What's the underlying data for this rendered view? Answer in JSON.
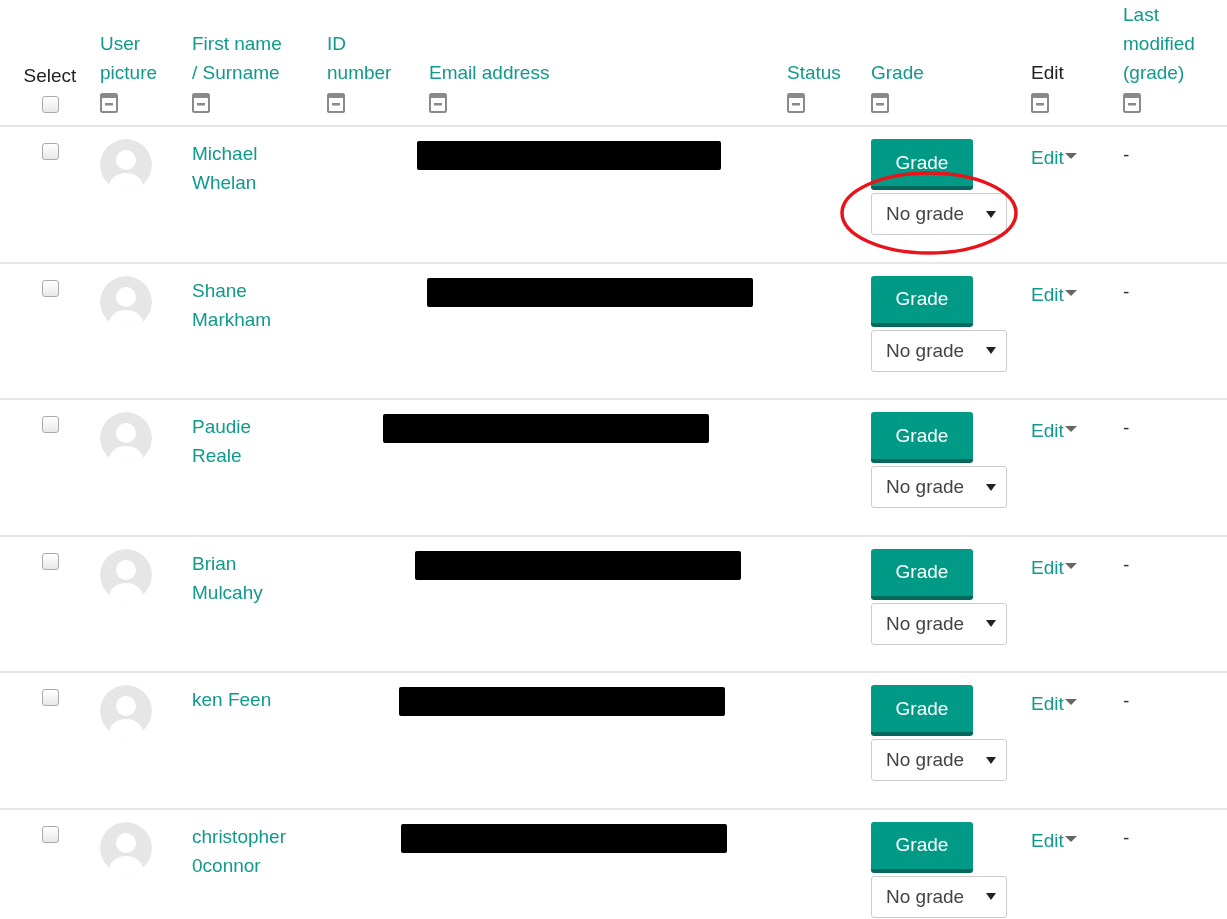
{
  "table": {
    "columns": [
      {
        "label": "Select",
        "sortable": false,
        "kind": "checkbox",
        "checked": false
      },
      {
        "label": "User picture",
        "sortable": true,
        "kind": "collapse"
      },
      {
        "label": "First name / Surname",
        "sortable": true,
        "kind": "collapse"
      },
      {
        "label": "ID number",
        "sortable": true,
        "kind": "collapse"
      },
      {
        "label": "Email address",
        "sortable": true,
        "kind": "collapse"
      },
      {
        "label": "Status",
        "sortable": true,
        "kind": "collapse"
      },
      {
        "label": "Grade",
        "sortable": true,
        "kind": "collapse"
      },
      {
        "label": "Edit",
        "sortable": false,
        "kind": "collapse"
      },
      {
        "label": "Last modified (grade)",
        "sortable": true,
        "kind": "collapse"
      }
    ],
    "rows": [
      {
        "checked": false,
        "first_name": "Michael",
        "surname": "Whelan",
        "grade_button": "Grade",
        "grade_select": "No grade",
        "edit": "Edit",
        "last_modified": "-",
        "circled": true
      },
      {
        "checked": false,
        "first_name": "Shane",
        "surname": "Markham",
        "grade_button": "Grade",
        "grade_select": "No grade",
        "edit": "Edit",
        "last_modified": "-",
        "circled": false
      },
      {
        "checked": false,
        "first_name": "Paudie",
        "surname": "Reale",
        "grade_button": "Grade",
        "grade_select": "No grade",
        "edit": "Edit",
        "last_modified": "-",
        "circled": false
      },
      {
        "checked": false,
        "first_name": "Brian",
        "surname": "Mulcahy",
        "grade_button": "Grade",
        "grade_select": "No grade",
        "edit": "Edit",
        "last_modified": "-",
        "circled": false
      },
      {
        "checked": false,
        "first_name": "ken Feen",
        "surname": "",
        "grade_button": "Grade",
        "grade_select": "No grade",
        "edit": "Edit",
        "last_modified": "-",
        "circled": false
      },
      {
        "checked": false,
        "first_name": "christopher",
        "surname": "0connor",
        "grade_button": "Grade",
        "grade_select": "No grade",
        "edit": "Edit",
        "last_modified": "-",
        "circled": false
      }
    ]
  }
}
